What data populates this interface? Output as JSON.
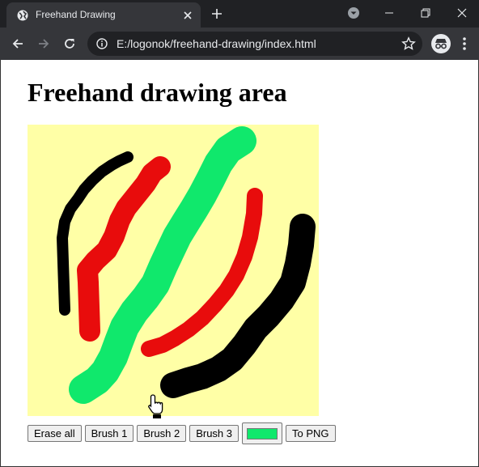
{
  "browser": {
    "tab_title": "Freehand Drawing",
    "url": "E:/logonok/freehand-drawing/index.html"
  },
  "page": {
    "heading": "Freehand drawing area"
  },
  "canvas": {
    "background": "#ffffa6",
    "strokes": [
      {
        "color": "#000000",
        "width": 14
      },
      {
        "color": "#e80c0c",
        "width": 26
      },
      {
        "color": "#10e86c",
        "width": 36
      },
      {
        "color": "#e80c0c",
        "width": 20
      },
      {
        "color": "#000000",
        "width": 32
      }
    ]
  },
  "controls": {
    "erase_label": "Erase all",
    "brush1_label": "Brush 1",
    "brush2_label": "Brush 2",
    "brush3_label": "Brush 3",
    "color_value": "#10e86c",
    "png_label": "To PNG"
  },
  "icons": [
    "globe-icon",
    "close-icon",
    "plus-icon",
    "profile-dropdown-icon",
    "minimize-icon",
    "restore-icon",
    "window-close-icon",
    "back-icon",
    "forward-icon",
    "reload-icon",
    "info-icon",
    "star-icon",
    "incognito-icon",
    "menu-icon",
    "hand-cursor-icon"
  ]
}
